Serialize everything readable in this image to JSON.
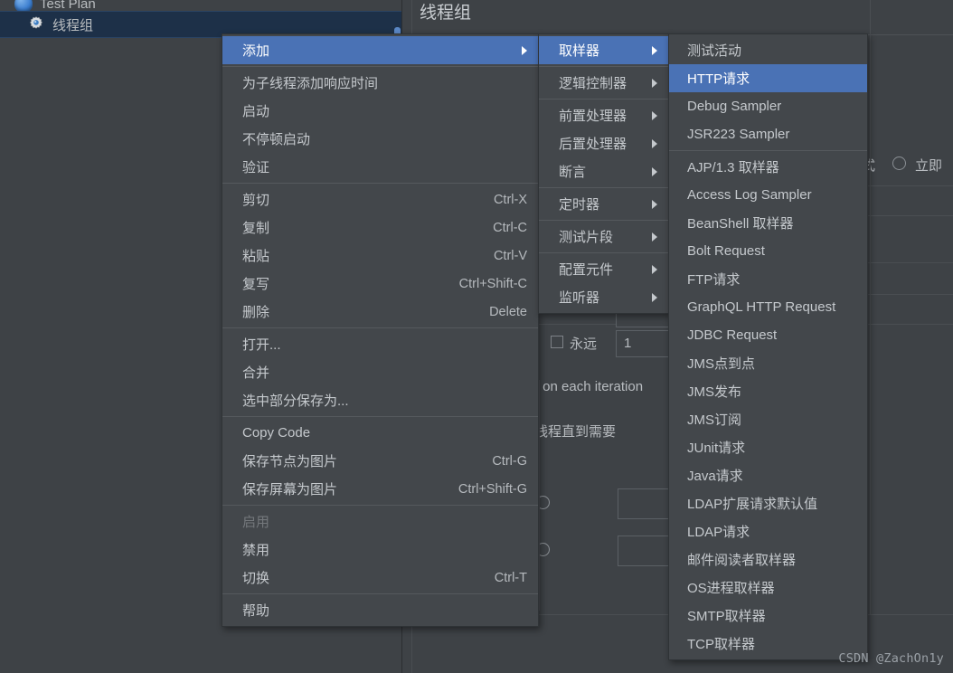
{
  "window": {
    "background_color": "#3e4246",
    "menu_background": "#43474b",
    "highlight_color": "#4a72b5",
    "tree_selection_color": "#1d3048"
  },
  "tree": {
    "items": [
      {
        "label": "Test Plan",
        "icon": "test-plan-icon",
        "selected": false
      },
      {
        "label": "线程组",
        "icon": "thread-group-gear-icon",
        "selected": true
      }
    ]
  },
  "right_panel": {
    "title": "线程组",
    "labels": {
      "forever": "永远",
      "loop_count_value": "1",
      "iteration_hint": "r on each iteration",
      "thread_hint": "线程直到需要",
      "mode": "式",
      "immediate": "立即"
    }
  },
  "context_menu": {
    "items": [
      {
        "label": "添加",
        "accel": "",
        "submenu": true,
        "selected": true,
        "disabled": false
      },
      {
        "separator": true
      },
      {
        "label": "为子线程添加响应时间",
        "accel": "",
        "submenu": false,
        "selected": false,
        "disabled": false
      },
      {
        "label": "启动",
        "accel": "",
        "submenu": false,
        "selected": false,
        "disabled": false
      },
      {
        "label": "不停顿启动",
        "accel": "",
        "submenu": false,
        "selected": false,
        "disabled": false
      },
      {
        "label": "验证",
        "accel": "",
        "submenu": false,
        "selected": false,
        "disabled": false
      },
      {
        "separator": true
      },
      {
        "label": "剪切",
        "accel": "Ctrl-X",
        "submenu": false,
        "selected": false,
        "disabled": false
      },
      {
        "label": "复制",
        "accel": "Ctrl-C",
        "submenu": false,
        "selected": false,
        "disabled": false
      },
      {
        "label": "粘贴",
        "accel": "Ctrl-V",
        "submenu": false,
        "selected": false,
        "disabled": false
      },
      {
        "label": "复写",
        "accel": "Ctrl+Shift-C",
        "submenu": false,
        "selected": false,
        "disabled": false
      },
      {
        "label": "删除",
        "accel": "Delete",
        "submenu": false,
        "selected": false,
        "disabled": false
      },
      {
        "separator": true
      },
      {
        "label": "打开...",
        "accel": "",
        "submenu": false,
        "selected": false,
        "disabled": false
      },
      {
        "label": "合并",
        "accel": "",
        "submenu": false,
        "selected": false,
        "disabled": false
      },
      {
        "label": "选中部分保存为...",
        "accel": "",
        "submenu": false,
        "selected": false,
        "disabled": false
      },
      {
        "separator": true
      },
      {
        "label": "Copy Code",
        "accel": "",
        "submenu": false,
        "selected": false,
        "disabled": false
      },
      {
        "label": "保存节点为图片",
        "accel": "Ctrl-G",
        "submenu": false,
        "selected": false,
        "disabled": false
      },
      {
        "label": "保存屏幕为图片",
        "accel": "Ctrl+Shift-G",
        "submenu": false,
        "selected": false,
        "disabled": false
      },
      {
        "separator": true
      },
      {
        "label": "启用",
        "accel": "",
        "submenu": false,
        "selected": false,
        "disabled": true
      },
      {
        "label": "禁用",
        "accel": "",
        "submenu": false,
        "selected": false,
        "disabled": false
      },
      {
        "label": "切换",
        "accel": "Ctrl-T",
        "submenu": false,
        "selected": false,
        "disabled": false
      },
      {
        "separator": true
      },
      {
        "label": "帮助",
        "accel": "",
        "submenu": false,
        "selected": false,
        "disabled": false
      }
    ]
  },
  "element_menu": {
    "items": [
      {
        "label": "取样器",
        "submenu": true,
        "selected": true
      },
      {
        "separator": true
      },
      {
        "label": "逻辑控制器",
        "submenu": true,
        "selected": false
      },
      {
        "separator": true
      },
      {
        "label": "前置处理器",
        "submenu": true,
        "selected": false
      },
      {
        "label": "后置处理器",
        "submenu": true,
        "selected": false
      },
      {
        "label": "断言",
        "submenu": true,
        "selected": false
      },
      {
        "separator": true
      },
      {
        "label": "定时器",
        "submenu": true,
        "selected": false
      },
      {
        "separator": true
      },
      {
        "label": "测试片段",
        "submenu": true,
        "selected": false
      },
      {
        "separator": true
      },
      {
        "label": "配置元件",
        "submenu": true,
        "selected": false
      },
      {
        "label": "监听器",
        "submenu": true,
        "selected": false
      }
    ]
  },
  "sampler_menu": {
    "items": [
      {
        "label": "测试活动",
        "selected": false
      },
      {
        "label": "HTTP请求",
        "selected": true
      },
      {
        "label": "Debug Sampler",
        "selected": false
      },
      {
        "label": "JSR223 Sampler",
        "selected": false
      },
      {
        "separator": true
      },
      {
        "label": "AJP/1.3 取样器",
        "selected": false
      },
      {
        "label": "Access Log Sampler",
        "selected": false
      },
      {
        "label": "BeanShell 取样器",
        "selected": false
      },
      {
        "label": "Bolt Request",
        "selected": false
      },
      {
        "label": "FTP请求",
        "selected": false
      },
      {
        "label": "GraphQL HTTP Request",
        "selected": false
      },
      {
        "label": "JDBC Request",
        "selected": false
      },
      {
        "label": "JMS点到点",
        "selected": false
      },
      {
        "label": "JMS发布",
        "selected": false
      },
      {
        "label": "JMS订阅",
        "selected": false
      },
      {
        "label": "JUnit请求",
        "selected": false
      },
      {
        "label": "Java请求",
        "selected": false
      },
      {
        "label": "LDAP扩展请求默认值",
        "selected": false
      },
      {
        "label": "LDAP请求",
        "selected": false
      },
      {
        "label": "邮件阅读者取样器",
        "selected": false
      },
      {
        "label": "OS进程取样器",
        "selected": false
      },
      {
        "label": "SMTP取样器",
        "selected": false
      },
      {
        "label": "TCP取样器",
        "selected": false
      }
    ]
  },
  "watermark": "CSDN @ZachOn1y"
}
